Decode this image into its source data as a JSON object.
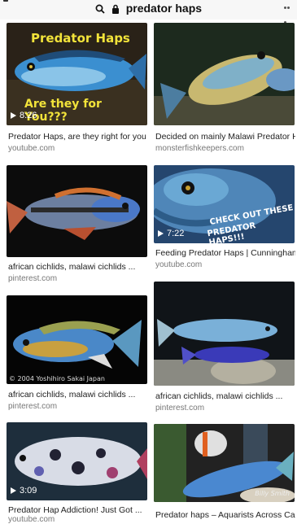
{
  "search": {
    "query": "predator haps"
  },
  "results": [
    {
      "title": "Predator Haps, are they right for you ...",
      "source": "youtube.com",
      "duration": "8:26",
      "overlay_top": "Predator Haps",
      "overlay_bottom": "Are they for You???"
    },
    {
      "title": "Decided on mainly Malawi Predator H...",
      "source": "monsterfishkeepers.com"
    },
    {
      "title": "african cichlids, malawi cichlids ...",
      "source": "pinterest.com"
    },
    {
      "title": "Feeding Predator Haps | Cunningham ...",
      "source": "youtube.com",
      "duration": "7:22",
      "overlay_line1": "CHECK OUT THESE",
      "overlay_line2": "PREDATOR HAPS!!!"
    },
    {
      "title": "african cichlids, malawi cichlids ...",
      "source": "pinterest.com",
      "watermark": "© 2004 Yoshihiro Sakai Japan"
    },
    {
      "title": "african cichlids, malawi cichlids ...",
      "source": "pinterest.com"
    },
    {
      "title": "Predator Hap Addiction! Just Got ...",
      "source": "youtube.com",
      "duration": "3:09"
    },
    {
      "title": "Predator haps – Aquarists Across Ca...",
      "source": "",
      "watermark": "Billy Smith"
    }
  ]
}
